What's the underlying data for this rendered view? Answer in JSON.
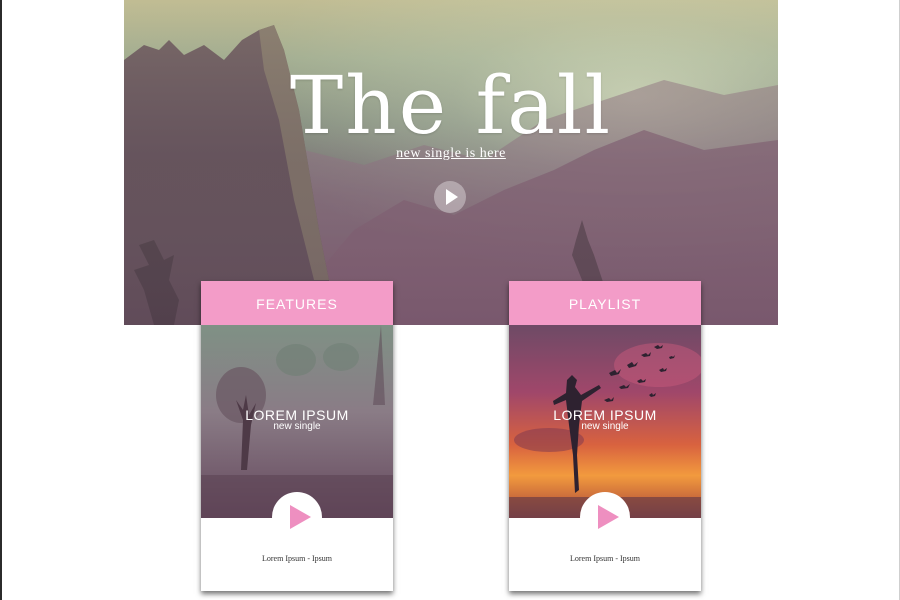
{
  "hero": {
    "title": "The fall",
    "subtitle": "new single is here",
    "play_icon": "play-icon"
  },
  "cards": [
    {
      "header": "FEATURES",
      "title": "LOREM IPSUM",
      "subtitle": "new single",
      "caption": "Lorem Ipsum - Ipsum",
      "image": "foggy-forest-tree"
    },
    {
      "header": "PLAYLIST",
      "title": "LOREM IPSUM",
      "subtitle": "new single",
      "caption": "Lorem Ipsum - Ipsum",
      "image": "sunset-silhouette-birds"
    }
  ],
  "colors": {
    "accent_pink": "#f39cc8",
    "play_pink": "#ee8fc0",
    "white": "#ffffff"
  }
}
